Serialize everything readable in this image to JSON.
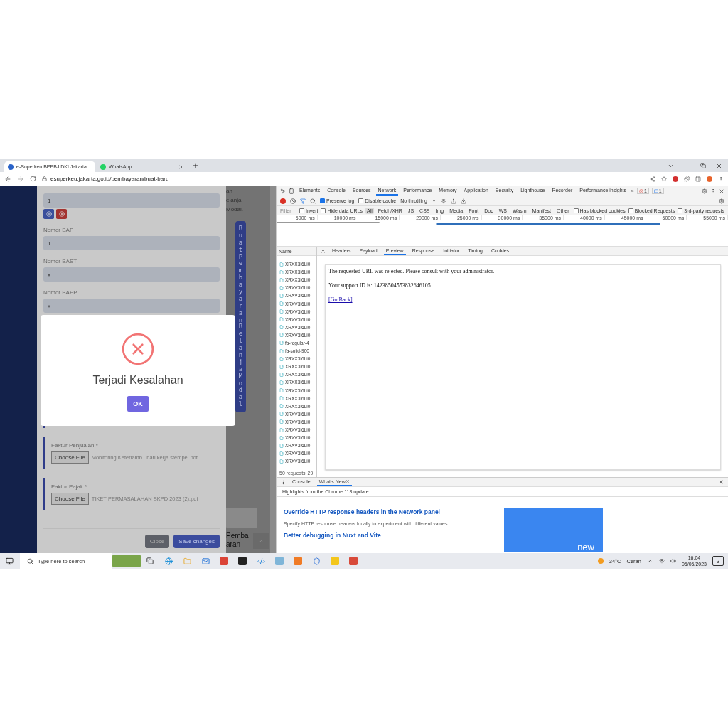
{
  "browser": {
    "tabs": [
      {
        "title": "e-Superkeu BPPBJ DKI Jakarta",
        "selected": true
      },
      {
        "title": "WhatsApp",
        "selected": false
      }
    ],
    "url": "esuperkeu.jakarta.go.id/pembayaran/buat-baru"
  },
  "page": {
    "form": {
      "fields": [
        {
          "kind": "text",
          "value": "1"
        },
        {
          "kind": "add_remove"
        },
        {
          "kind": "text",
          "label": "Nomor BAP",
          "value": "1"
        },
        {
          "kind": "text",
          "label": "Nomor BAST",
          "value": "x"
        },
        {
          "kind": "text",
          "label": "Nomor BAPP",
          "value": "x"
        }
      ],
      "uploads": [
        {
          "label": "Faktur Penjualan *",
          "button": "Choose File",
          "file": "Monitoring Keterlamb...hari kerja stempel.pdf"
        },
        {
          "label": "Faktur Pajak *",
          "button": "Choose File",
          "file": "TIKET PERMASALAHAN SKPD 2023 (2).pdf"
        }
      ],
      "buttons": [
        {
          "label": "Close",
          "kind": "secondary"
        },
        {
          "label": "Save changes",
          "kind": "primary"
        }
      ]
    },
    "side_text": [
      "an",
      "elanja",
      "Modal."
    ],
    "vertical_button": "Buat Pembayaran Belanja Modal",
    "bottom_text": [
      "Pemba",
      "aran"
    ]
  },
  "dialog": {
    "title": "Terjadi Kesalahan",
    "button": "OK"
  },
  "devtools": {
    "tabs": [
      {
        "label": "Elements",
        "selected": false
      },
      {
        "label": "Console",
        "selected": false
      },
      {
        "label": "Sources",
        "selected": false
      },
      {
        "label": "Network",
        "selected": true
      },
      {
        "label": "Performance",
        "selected": false
      },
      {
        "label": "Memory",
        "selected": false
      },
      {
        "label": "Application",
        "selected": false
      },
      {
        "label": "Security",
        "selected": false
      },
      {
        "label": "Lighthouse",
        "selected": false
      },
      {
        "label": "Recorder",
        "selected": false
      },
      {
        "label": "Performance insights",
        "selected": false
      }
    ],
    "more": "»",
    "errors": "1",
    "messages": "1",
    "preserve_log": {
      "label": "Preserve log",
      "checked": true
    },
    "disable_cache": {
      "label": "Disable cache",
      "checked": false
    },
    "throttling": "No throttling",
    "filter_placeholder": "Filter",
    "filter_checks": [
      {
        "label": "Invert",
        "checked": false
      },
      {
        "label": "Hide data URLs",
        "checked": false
      }
    ],
    "types": [
      {
        "label": "All",
        "selected": true
      },
      {
        "label": "Fetch/XHR",
        "selected": false
      },
      {
        "label": "JS",
        "selected": false
      },
      {
        "label": "CSS",
        "selected": false
      },
      {
        "label": "Img",
        "selected": false
      },
      {
        "label": "Media",
        "selected": false
      },
      {
        "label": "Font",
        "selected": false
      },
      {
        "label": "Doc",
        "selected": false
      },
      {
        "label": "WS",
        "selected": false
      },
      {
        "label": "Wasm",
        "selected": false
      },
      {
        "label": "Manifest",
        "selected": false
      },
      {
        "label": "Other",
        "selected": false
      }
    ],
    "extra_checks": [
      {
        "label": "Has blocked cookies",
        "checked": false
      },
      {
        "label": "Blocked Requests",
        "checked": false
      },
      {
        "label": "3rd-party requests",
        "checked": false
      }
    ],
    "ticks": [
      "5000 ms",
      "10000 ms",
      "15000 ms",
      "20000 ms",
      "25000 ms",
      "30000 ms",
      "35000 ms",
      "40000 ms",
      "45000 ms",
      "50000 ms",
      "55000 ms"
    ],
    "name_header": "Name",
    "requests": [
      "XRXX3I6Li0",
      "XRXX3I6Li0",
      "XRXX3I6Li0",
      "XRXV3I6Li0",
      "XRXV3I6Li0",
      "XRXV3I6Li0",
      "XRXV3I6Li0",
      "XRXV3I6Li0",
      "XRXV3I6Li0",
      "XRXV3I6Li0",
      "fa-regular-4",
      "fa-solid-900",
      "XRXX3I6Li0",
      "XRXX3I6Li0",
      "XRXX3I6Li0",
      "XRXX3I6Li0",
      "XRXX3I6Li0",
      "XRXX3I6Li0",
      "XRXX3I6Li0",
      "XRXV3I6Li0",
      "XRXV3I6Li0",
      "XRXV3I6Li0",
      "XRXV3I6Li0",
      "XRXV3I6Li0",
      "XRXV3I6Li0",
      "XRXV3I6Li0"
    ],
    "status": [
      "50 requests",
      "29"
    ],
    "detail_tabs": [
      {
        "label": "Headers",
        "selected": false
      },
      {
        "label": "Payload",
        "selected": false
      },
      {
        "label": "Preview",
        "selected": true
      },
      {
        "label": "Response",
        "selected": false
      },
      {
        "label": "Initiator",
        "selected": false
      },
      {
        "label": "Timing",
        "selected": false
      },
      {
        "label": "Cookies",
        "selected": false
      }
    ],
    "preview": {
      "message": "The requested URL was rejected. Please consult with your administrator.",
      "support": "Your support ID is: 14238504553832646105",
      "link": "[Go Back]"
    },
    "drawer": {
      "tabs": [
        {
          "label": "Console",
          "selected": false
        },
        {
          "label": "What's New",
          "selected": true
        }
      ],
      "highlights": "Highlights from the Chrome 113 update",
      "features": [
        {
          "title": "Override HTTP response headers in the Network panel",
          "text": "Specify HTTP response headers locally to experiment with different values."
        },
        {
          "title": "Better debugging in Nuxt and Vite"
        }
      ],
      "video_label": "new"
    }
  },
  "taskbar": {
    "search_placeholder": "Type here to search",
    "temperature": "34°C",
    "weather": "Cerah",
    "time": "16:04",
    "date": "05/05/2023",
    "notifications": "3"
  }
}
